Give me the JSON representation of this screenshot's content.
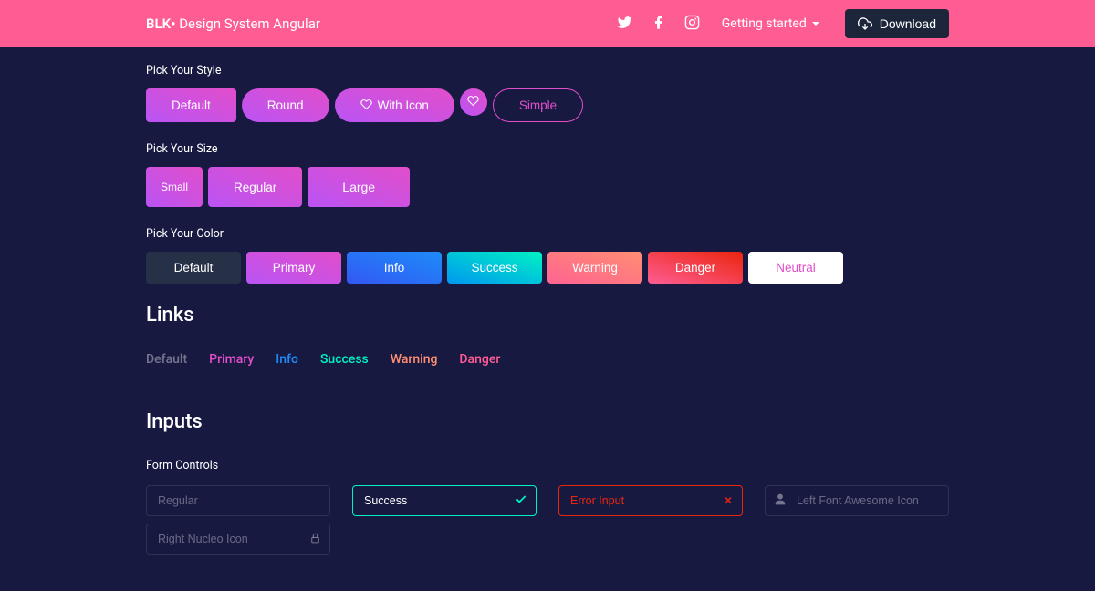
{
  "nav": {
    "brand_bold": "BLK•",
    "brand_rest": " Design System Angular",
    "getting_started": "Getting started",
    "download": "Download"
  },
  "styles": {
    "label": "Pick Your Style",
    "default": "Default",
    "round": "Round",
    "with_icon": "With Icon",
    "simple": "Simple"
  },
  "sizes": {
    "label": "Pick Your Size",
    "small": "Small",
    "regular": "Regular",
    "large": "Large"
  },
  "colors": {
    "label": "Pick Your Color",
    "default": "Default",
    "primary": "Primary",
    "info": "Info",
    "success": "Success",
    "warning": "Warning",
    "danger": "Danger",
    "neutral": "Neutral"
  },
  "links": {
    "heading": "Links",
    "default": "Default",
    "primary": "Primary",
    "info": "Info",
    "success": "Success",
    "warning": "Warning",
    "danger": "Danger"
  },
  "inputs": {
    "heading": "Inputs",
    "form_controls": "Form Controls",
    "regular_placeholder": "Regular",
    "success_value": "Success",
    "error_value": "Error Input",
    "left_icon_placeholder": "Left Font Awesome Icon",
    "right_icon_placeholder": "Right Nucleo Icon"
  }
}
